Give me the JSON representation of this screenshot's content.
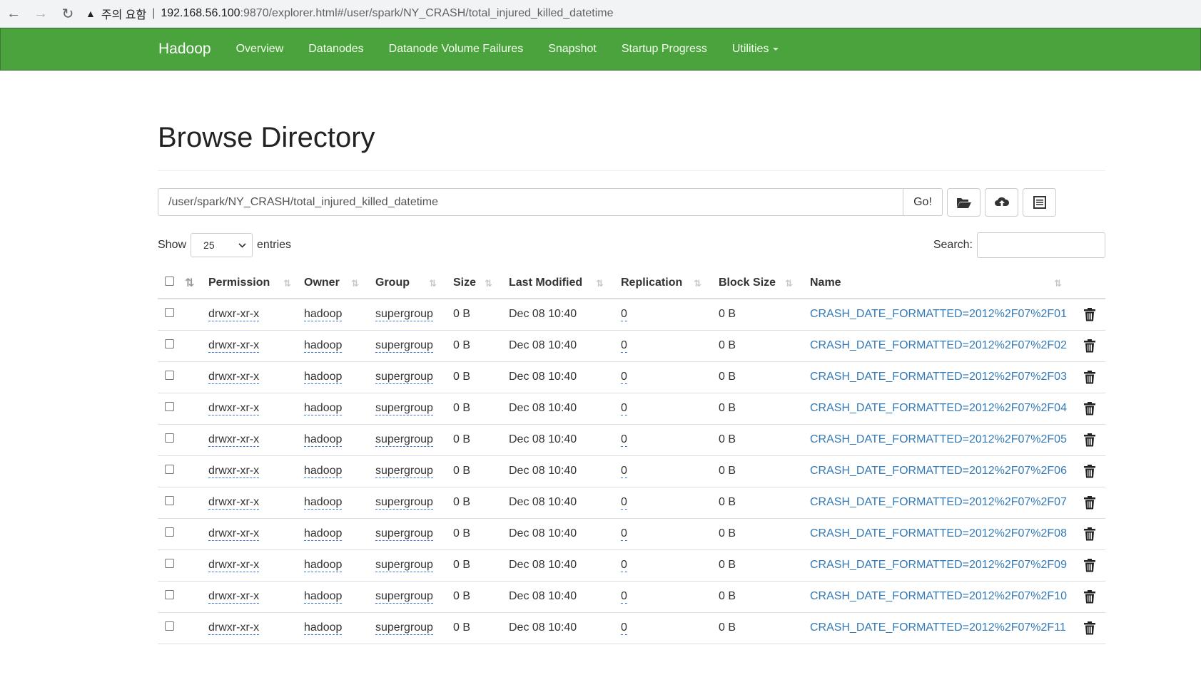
{
  "browser": {
    "warning_label": "주의 요함",
    "url_host": "192.168.56.100",
    "url_rest": ":9870/explorer.html#/user/spark/NY_CRASH/total_injured_killed_datetime"
  },
  "navbar": {
    "brand": "Hadoop",
    "links": [
      "Overview",
      "Datanodes",
      "Datanode Volume Failures",
      "Snapshot",
      "Startup Progress",
      "Utilities"
    ]
  },
  "page": {
    "title": "Browse Directory",
    "path": "/user/spark/NY_CRASH/total_injured_killed_datetime",
    "go_label": "Go!"
  },
  "controls": {
    "show_label": "Show",
    "entries_value": "25",
    "entries_label": "entries",
    "search_label": "Search:"
  },
  "table": {
    "headers": [
      "Permission",
      "Owner",
      "Group",
      "Size",
      "Last Modified",
      "Replication",
      "Block Size",
      "Name"
    ],
    "rows": [
      {
        "permission": "drwxr-xr-x",
        "owner": "hadoop",
        "group": "supergroup",
        "size": "0 B",
        "modified": "Dec 08 10:40",
        "replication": "0",
        "block_size": "0 B",
        "name": "CRASH_DATE_FORMATTED=2012%2F07%2F01"
      },
      {
        "permission": "drwxr-xr-x",
        "owner": "hadoop",
        "group": "supergroup",
        "size": "0 B",
        "modified": "Dec 08 10:40",
        "replication": "0",
        "block_size": "0 B",
        "name": "CRASH_DATE_FORMATTED=2012%2F07%2F02"
      },
      {
        "permission": "drwxr-xr-x",
        "owner": "hadoop",
        "group": "supergroup",
        "size": "0 B",
        "modified": "Dec 08 10:40",
        "replication": "0",
        "block_size": "0 B",
        "name": "CRASH_DATE_FORMATTED=2012%2F07%2F03"
      },
      {
        "permission": "drwxr-xr-x",
        "owner": "hadoop",
        "group": "supergroup",
        "size": "0 B",
        "modified": "Dec 08 10:40",
        "replication": "0",
        "block_size": "0 B",
        "name": "CRASH_DATE_FORMATTED=2012%2F07%2F04"
      },
      {
        "permission": "drwxr-xr-x",
        "owner": "hadoop",
        "group": "supergroup",
        "size": "0 B",
        "modified": "Dec 08 10:40",
        "replication": "0",
        "block_size": "0 B",
        "name": "CRASH_DATE_FORMATTED=2012%2F07%2F05"
      },
      {
        "permission": "drwxr-xr-x",
        "owner": "hadoop",
        "group": "supergroup",
        "size": "0 B",
        "modified": "Dec 08 10:40",
        "replication": "0",
        "block_size": "0 B",
        "name": "CRASH_DATE_FORMATTED=2012%2F07%2F06"
      },
      {
        "permission": "drwxr-xr-x",
        "owner": "hadoop",
        "group": "supergroup",
        "size": "0 B",
        "modified": "Dec 08 10:40",
        "replication": "0",
        "block_size": "0 B",
        "name": "CRASH_DATE_FORMATTED=2012%2F07%2F07"
      },
      {
        "permission": "drwxr-xr-x",
        "owner": "hadoop",
        "group": "supergroup",
        "size": "0 B",
        "modified": "Dec 08 10:40",
        "replication": "0",
        "block_size": "0 B",
        "name": "CRASH_DATE_FORMATTED=2012%2F07%2F08"
      },
      {
        "permission": "drwxr-xr-x",
        "owner": "hadoop",
        "group": "supergroup",
        "size": "0 B",
        "modified": "Dec 08 10:40",
        "replication": "0",
        "block_size": "0 B",
        "name": "CRASH_DATE_FORMATTED=2012%2F07%2F09"
      },
      {
        "permission": "drwxr-xr-x",
        "owner": "hadoop",
        "group": "supergroup",
        "size": "0 B",
        "modified": "Dec 08 10:40",
        "replication": "0",
        "block_size": "0 B",
        "name": "CRASH_DATE_FORMATTED=2012%2F07%2F10"
      },
      {
        "permission": "drwxr-xr-x",
        "owner": "hadoop",
        "group": "supergroup",
        "size": "0 B",
        "modified": "Dec 08 10:40",
        "replication": "0",
        "block_size": "0 B",
        "name": "CRASH_DATE_FORMATTED=2012%2F07%2F11"
      }
    ]
  },
  "colors": {
    "navbar_green": "#4aa33c",
    "link_blue": "#337ab7"
  }
}
